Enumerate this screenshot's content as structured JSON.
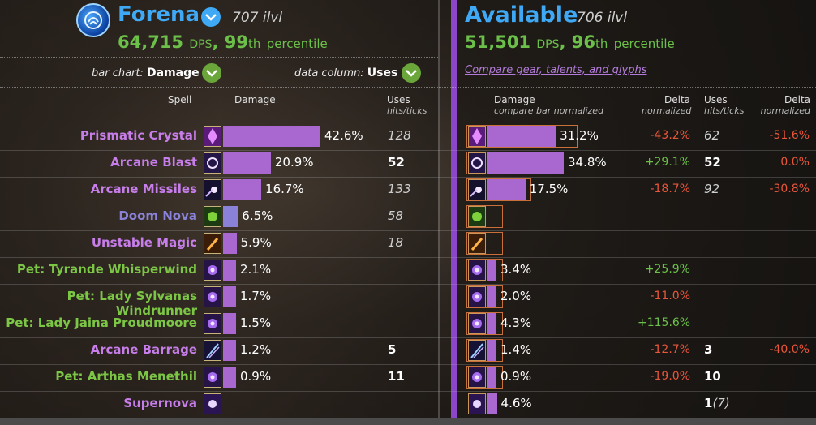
{
  "left": {
    "character_name": "Forena",
    "ilvl": "707 ilvl",
    "dps_value": "64,715",
    "dps_unit": "DPS",
    "percentile_num": "99",
    "percentile_suffix": "th",
    "percentile_word": "percentile",
    "bar_chart_label": "bar chart:",
    "bar_chart_value": "Damage",
    "data_column_label": "data column:",
    "data_column_value": "Uses"
  },
  "right": {
    "title": "Available",
    "ilvl": "706 ilvl",
    "dps_value": "51,501",
    "dps_unit": "DPS",
    "percentile_num": "96",
    "percentile_suffix": "th",
    "percentile_word": "percentile",
    "compare_link": "Compare gear, talents, and glyphs"
  },
  "columns": {
    "spell": "Spell",
    "damage": "Damage",
    "uses": "Uses",
    "uses_sub": "hits/ticks",
    "damage_right": "Damage",
    "damage_right_sub": "compare bar normalized",
    "delta": "Delta",
    "delta_sub": "normalized",
    "uses_right": "Uses",
    "uses_right_sub": "hits/ticks",
    "delta2": "Delta",
    "delta2_sub": "normalized"
  },
  "colors": {
    "blue_name": "#3fa9f5",
    "green": "#6cc04a",
    "purple_bar": "#a868cf",
    "purple_divider": "#8b46c9",
    "red": "#e8563a",
    "pet_green": "#7cc646",
    "doom_purple": "#8a82d8"
  },
  "rows": [
    {
      "name": "Prismatic Crystal",
      "color": "#c77dea",
      "icon": "prismatic-crystal-icon",
      "left_pct": "42.6%",
      "left_val": 42.6,
      "left_uses": "128",
      "left_uses_style": "it",
      "right_pct": "31.2%",
      "right_val": 31.2,
      "right_outline": 42.6,
      "delta": "-43.2%",
      "delta_color": "#e8563a",
      "right_uses": "62",
      "right_uses_style": "it",
      "right_uses_extra": "",
      "delta2": "-51.6%",
      "delta2_color": "#e8563a"
    },
    {
      "name": "Arcane Blast",
      "color": "#c77dea",
      "icon": "arcane-blast-icon",
      "left_pct": "20.9%",
      "left_val": 20.9,
      "left_uses": "52",
      "left_uses_style": "bold",
      "right_pct": "34.8%",
      "right_val": 34.8,
      "right_outline": 27.0,
      "delta": "+29.1%",
      "delta_color": "#6cc04a",
      "right_uses": "52",
      "right_uses_style": "bold",
      "right_uses_extra": "",
      "delta2": "0.0%",
      "delta2_color": "#e8563a"
    },
    {
      "name": "Arcane Missiles",
      "color": "#c77dea",
      "icon": "arcane-missiles-icon",
      "left_pct": "16.7%",
      "left_val": 16.7,
      "left_uses": "133",
      "left_uses_style": "it",
      "right_pct": "17.5%",
      "right_val": 17.5,
      "right_outline": 21.5,
      "delta": "-18.7%",
      "delta_color": "#e8563a",
      "right_uses": "92",
      "right_uses_style": "it",
      "right_uses_extra": "",
      "delta2": "-30.8%",
      "delta2_color": "#e8563a"
    },
    {
      "name": "Doom Nova",
      "color": "#8a82d8",
      "icon": "doom-nova-icon",
      "left_pct": "6.5%",
      "left_val": 6.5,
      "left_uses": "58",
      "left_uses_style": "it",
      "right_pct": "",
      "right_val": 0,
      "right_outline": 8.4,
      "delta": "",
      "delta_color": "#e8563a",
      "right_uses": "",
      "right_uses_style": "it",
      "right_uses_extra": "",
      "delta2": "",
      "delta2_color": "#e8563a"
    },
    {
      "name": "Unstable Magic",
      "color": "#c77dea",
      "icon": "unstable-magic-icon",
      "left_pct": "5.9%",
      "left_val": 5.9,
      "left_uses": "18",
      "left_uses_style": "it",
      "right_pct": "",
      "right_val": 0,
      "right_outline": 7.6,
      "delta": "",
      "delta_color": "#e8563a",
      "right_uses": "",
      "right_uses_style": "it",
      "right_uses_extra": "",
      "delta2": "",
      "delta2_color": "#e8563a"
    },
    {
      "name": "Pet: Tyrande Whisperwind",
      "color": "#7cc646",
      "icon": "pet-orb-icon",
      "left_pct": "2.1%",
      "left_val": 2.1,
      "left_uses": "",
      "left_uses_style": "it",
      "right_pct": "3.4%",
      "right_val": 3.4,
      "right_outline": 2.7,
      "delta": "+25.9%",
      "delta_color": "#6cc04a",
      "right_uses": "",
      "right_uses_style": "it",
      "right_uses_extra": "",
      "delta2": "",
      "delta2_color": "#e8563a"
    },
    {
      "name": "Pet: Lady Sylvanas Windrunner",
      "color": "#7cc646",
      "icon": "pet-orb-icon",
      "left_pct": "1.7%",
      "left_val": 1.7,
      "left_uses": "",
      "left_uses_style": "it",
      "right_pct": "2.0%",
      "right_val": 2.0,
      "right_outline": 2.2,
      "delta": "-11.0%",
      "delta_color": "#e8563a",
      "right_uses": "",
      "right_uses_style": "it",
      "right_uses_extra": "",
      "delta2": "",
      "delta2_color": "#e8563a"
    },
    {
      "name": "Pet: Lady Jaina Proudmoore",
      "color": "#7cc646",
      "icon": "pet-orb-icon",
      "left_pct": "1.5%",
      "left_val": 1.5,
      "left_uses": "",
      "left_uses_style": "it",
      "right_pct": "4.3%",
      "right_val": 4.3,
      "right_outline": 1.9,
      "delta": "+115.6%",
      "delta_color": "#6cc04a",
      "right_uses": "",
      "right_uses_style": "it",
      "right_uses_extra": "",
      "delta2": "",
      "delta2_color": "#e8563a"
    },
    {
      "name": "Arcane Barrage",
      "color": "#c77dea",
      "icon": "arcane-barrage-icon",
      "left_pct": "1.2%",
      "left_val": 1.2,
      "left_uses": "5",
      "left_uses_style": "bold",
      "right_pct": "1.4%",
      "right_val": 1.4,
      "right_outline": 1.5,
      "delta": "-12.7%",
      "delta_color": "#e8563a",
      "right_uses": "3",
      "right_uses_style": "bold",
      "right_uses_extra": "",
      "delta2": "-40.0%",
      "delta2_color": "#e8563a"
    },
    {
      "name": "Pet: Arthas Menethil",
      "color": "#7cc646",
      "icon": "pet-orb-icon",
      "left_pct": "0.9%",
      "left_val": 0.9,
      "left_uses": "11",
      "left_uses_style": "bold",
      "right_pct": "0.9%",
      "right_val": 0.9,
      "right_outline": 1.1,
      "delta": "-19.0%",
      "delta_color": "#e8563a",
      "right_uses": "10",
      "right_uses_style": "bold",
      "right_uses_extra": "",
      "delta2": "",
      "delta2_color": "#e8563a"
    },
    {
      "name": "Supernova",
      "color": "#c77dea",
      "icon": "supernova-icon",
      "left_pct": "",
      "left_val": 0,
      "left_uses": "",
      "left_uses_style": "bold",
      "right_pct": "4.6%",
      "right_val": 4.6,
      "right_outline": 0,
      "delta": "",
      "delta_color": "#e8563a",
      "right_uses": "1",
      "right_uses_style": "bold",
      "right_uses_extra": "(7)",
      "delta2": "",
      "delta2_color": "#e8563a"
    }
  ]
}
